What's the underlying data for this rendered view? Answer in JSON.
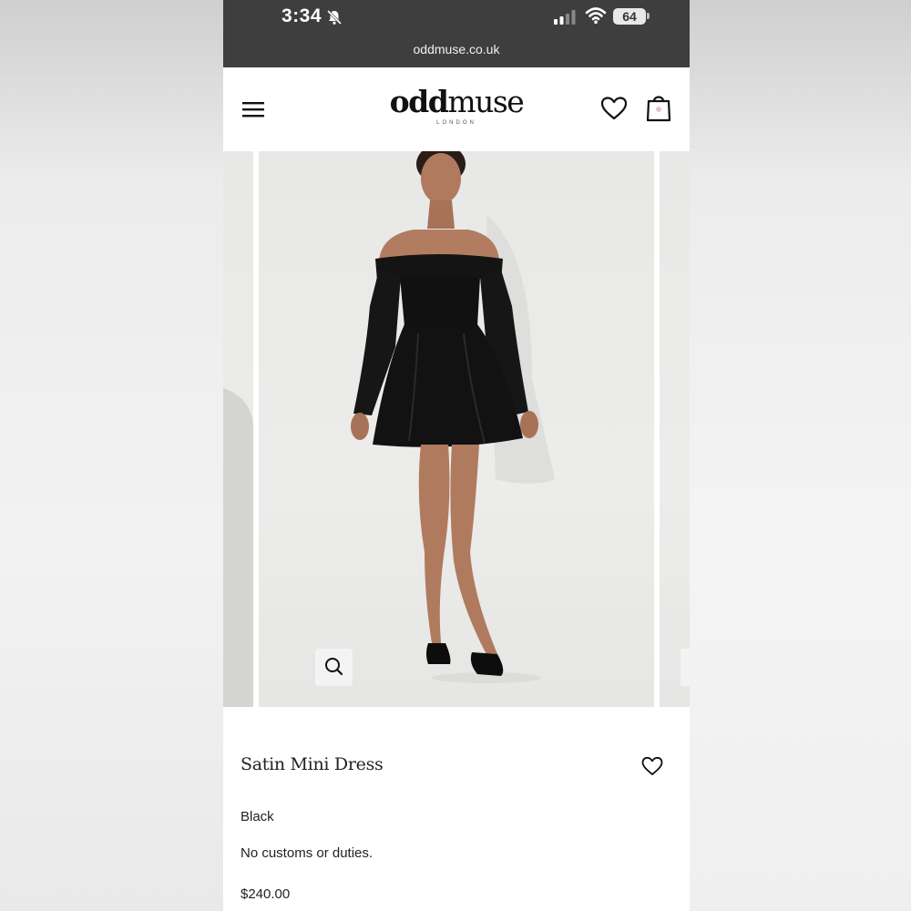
{
  "status_bar": {
    "time": "3:34",
    "battery": "64",
    "icons": [
      "bell-muted-icon",
      "signal-icon",
      "wifi-icon",
      "battery-icon"
    ]
  },
  "browser": {
    "url": "oddmuse.co.uk"
  },
  "header": {
    "logo_bold": "odd",
    "logo_light": "muse",
    "logo_sub": "LONDON",
    "icons": [
      "menu-icon",
      "heart-icon",
      "bag-icon"
    ]
  },
  "product": {
    "name": "Satin Mini Dress",
    "color": "Black",
    "shipping_note": "No customs or duties.",
    "price": "$240.00"
  },
  "gallery": {
    "zoom_icon": "magnifier-icon"
  },
  "colors": {
    "status_bar": "#3e3e3e",
    "text": "#222222",
    "dress": "#111111"
  }
}
